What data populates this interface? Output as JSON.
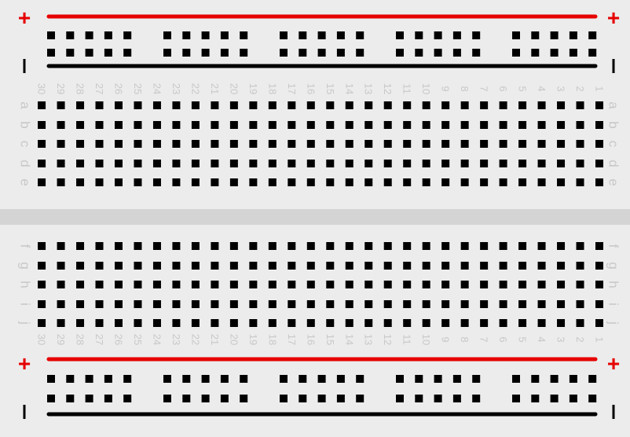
{
  "board": {
    "columns": [
      "1",
      "2",
      "3",
      "4",
      "5",
      "6",
      "7",
      "8",
      "9",
      "10",
      "11",
      "12",
      "13",
      "14",
      "15",
      "16",
      "17",
      "18",
      "19",
      "20",
      "21",
      "22",
      "23",
      "24",
      "25",
      "26",
      "27",
      "28",
      "29",
      "30"
    ],
    "rows_top": [
      "a",
      "b",
      "c",
      "d",
      "e"
    ],
    "rows_bottom": [
      "f",
      "g",
      "h",
      "i",
      "j"
    ],
    "plus_sign": "+",
    "minus_sign": "−",
    "colors": {
      "board": "#ececec",
      "channel": "#d4d4d4",
      "hole": "#000000",
      "positive_rail": "#e60000",
      "negative_rail": "#000000",
      "label": "#c8c8c8"
    }
  }
}
